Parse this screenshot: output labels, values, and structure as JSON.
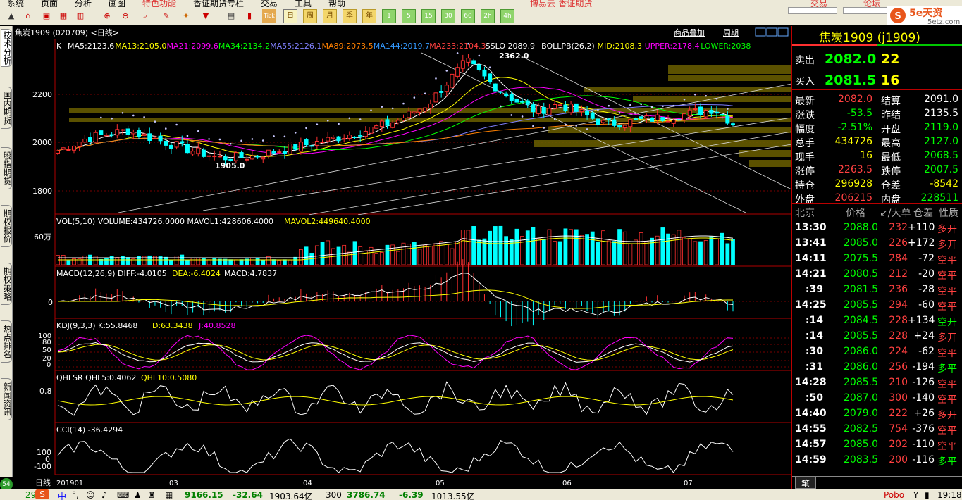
{
  "menubar": {
    "items": [
      "系统",
      "页面",
      "分析",
      "画图",
      "特色功能",
      "香证期货专栏",
      "交易",
      "工具",
      "帮助"
    ],
    "ad": "博易云-香证期货",
    "trade_btn": "交易",
    "forum_btn": "论坛"
  },
  "logo": {
    "main": "5e天资",
    "sub": "5etz.com"
  },
  "toolbar": {
    "day_btn": "日",
    "week_btn": "周",
    "month_btn": "月",
    "season_btn": "季",
    "year_btn": "年",
    "m1": "1",
    "m5": "5",
    "m15": "15",
    "m30": "30",
    "m60": "60",
    "h2": "2h",
    "h4": "4h"
  },
  "left_tabs": [
    "技术分析",
    "国内期货",
    "股指期货",
    "期权报价",
    "期权策略",
    "热点排名",
    "新闻资讯"
  ],
  "chart_header": {
    "symbol": "焦炭1909 (020709) <日线>",
    "link1": "商品叠加",
    "link2": "周期"
  },
  "price_pane": {
    "k_label": "K",
    "ma": [
      {
        "label": "MA5:2123.6",
        "color": "#ffffff"
      },
      {
        "label": "MA13:2105.0",
        "color": "#ffff00"
      },
      {
        "label": "MA21:2099.6",
        "color": "#ff00ff"
      },
      {
        "label": "MA34:2134.2",
        "color": "#00ff00"
      },
      {
        "label": "MA55:2126.1",
        "color": "#8080ff"
      },
      {
        "label": "MA89:2073.5",
        "color": "#ff8000"
      },
      {
        "label": "MA144:2019.7",
        "color": "#3399ff"
      },
      {
        "label": "MA233:2104.3",
        "color": "#ff4040"
      },
      {
        "label": "SSLO  2089.9",
        "color": "#ffffff"
      },
      {
        "label": "BOLLPB(26,2)",
        "color": "#ffffff"
      },
      {
        "label": "MID:2108.3",
        "color": "#ffff00"
      },
      {
        "label": "UPPER:2178.4",
        "color": "#ff00ff"
      },
      {
        "label": "LOWER:2038",
        "color": "#00ff00"
      }
    ],
    "y_ticks": [
      "2200",
      "2000",
      "1800"
    ],
    "high_label": "2362.0",
    "low_label": "1905.0"
  },
  "vol_pane": {
    "label": "VOL(5,10)  VOLUME:434726.0000  MAVOL1:428606.4000",
    "label2": "MAVOL2:449640.4000",
    "y_tick": "60万"
  },
  "macd_pane": {
    "label": "MACD(12,26,9)  DIFF:-4.0105",
    "dea": "DEA:-6.4024",
    "macd": "MACD:4.7837",
    "y_tick": "0"
  },
  "kdj_pane": {
    "label": "KDJ(9,3,3)  K:55.8468",
    "d": "D:63.3438",
    "j": "J:40.8528",
    "y_ticks": [
      "100",
      "80",
      "50",
      "20",
      "0"
    ]
  },
  "qhlsr_pane": {
    "label": "QHLSR  QHL5:0.4062",
    "l10": "QHL10:0.5080",
    "y_tick": "0.8"
  },
  "cci_pane": {
    "label": "CCI(14)  -36.4294",
    "y_ticks": [
      "100",
      "0",
      "-100"
    ]
  },
  "x_axis": {
    "period": "日线",
    "ticks": [
      "201901",
      "03",
      "04",
      "05",
      "06",
      "07"
    ]
  },
  "quote": {
    "title": "焦炭1909 (j1909)",
    "ask_label": "卖出",
    "ask_price": "2082.0",
    "ask_vol": "22",
    "bid_label": "买入",
    "bid_price": "2081.5",
    "bid_vol": "16",
    "rows": [
      {
        "l1": "最新",
        "v1": "2082.0",
        "c1": "#ff4040",
        "l2": "结算",
        "v2": "2091.0",
        "c2": "#ffffff"
      },
      {
        "l1": "涨跌",
        "v1": "-53.5",
        "c1": "#00ff00",
        "l2": "昨结",
        "v2": "2135.5",
        "c2": "#ffffff"
      },
      {
        "l1": "幅度",
        "v1": "-2.51%",
        "c1": "#00ff00",
        "l2": "开盘",
        "v2": "2119.0",
        "c2": "#00ff00"
      },
      {
        "l1": "总手",
        "v1": "434726",
        "c1": "#ffff00",
        "l2": "最高",
        "v2": "2127.0",
        "c2": "#00ff00"
      },
      {
        "l1": "现手",
        "v1": "16",
        "c1": "#ffff00",
        "l2": "最低",
        "v2": "2068.5",
        "c2": "#00ff00"
      },
      {
        "l1": "涨停",
        "v1": "2263.5",
        "c1": "#ff4040",
        "l2": "跌停",
        "v2": "2007.5",
        "c2": "#00ff00"
      },
      {
        "l1": "持仓",
        "v1": "296928",
        "c1": "#ffff00",
        "l2": "仓差",
        "v2": "-8542",
        "c2": "#ffff00"
      },
      {
        "l1": "外盘",
        "v1": "206215",
        "c1": "#ff4040",
        "l2": "内盘",
        "v2": "228511",
        "c2": "#00ff00"
      }
    ],
    "tick_header": {
      "c1": "北京",
      "c2": "价格",
      "c3": "↙/大单",
      "c4": "仓差",
      "c5": "性质"
    },
    "ticks": [
      {
        "t": "13:30",
        "p": "2088.0",
        "v": "232",
        "d": "+110",
        "n": "多开",
        "nc": "#ff4040"
      },
      {
        "t": "13:41",
        "p": "2085.0",
        "v": "226",
        "d": "+172",
        "n": "多开",
        "nc": "#ff4040"
      },
      {
        "t": "14:11",
        "p": "2075.5",
        "v": "284",
        "d": "-72",
        "n": "空平",
        "nc": "#ff4040"
      },
      {
        "t": "14:21",
        "p": "2080.5",
        "v": "212",
        "d": "-20",
        "n": "空平",
        "nc": "#ff4040"
      },
      {
        "t": ":39",
        "p": "2081.5",
        "v": "236",
        "d": "-28",
        "n": "空平",
        "nc": "#ff4040"
      },
      {
        "t": "14:25",
        "p": "2085.5",
        "v": "294",
        "d": "-60",
        "n": "空平",
        "nc": "#ff4040"
      },
      {
        "t": ":14",
        "p": "2084.5",
        "v": "228",
        "d": "+134",
        "n": "空开",
        "nc": "#00ff00"
      },
      {
        "t": ":14",
        "p": "2085.5",
        "v": "228",
        "d": "+24",
        "n": "多开",
        "nc": "#ff4040"
      },
      {
        "t": ":30",
        "p": "2086.0",
        "v": "224",
        "d": "-62",
        "n": "空平",
        "nc": "#ff4040"
      },
      {
        "t": ":31",
        "p": "2086.0",
        "v": "256",
        "d": "-194",
        "n": "多平",
        "nc": "#00ff00"
      },
      {
        "t": "14:28",
        "p": "2085.5",
        "v": "210",
        "d": "-126",
        "n": "空平",
        "nc": "#ff4040"
      },
      {
        "t": ":50",
        "p": "2087.0",
        "v": "300",
        "d": "-140",
        "n": "空平",
        "nc": "#ff4040"
      },
      {
        "t": "14:40",
        "p": "2079.0",
        "v": "222",
        "d": "+26",
        "n": "多开",
        "nc": "#ff4040"
      },
      {
        "t": "14:55",
        "p": "2082.5",
        "v": "754",
        "d": "-376",
        "n": "空平",
        "nc": "#ff4040"
      },
      {
        "t": "14:57",
        "p": "2085.0",
        "v": "202",
        "d": "-110",
        "n": "空平",
        "nc": "#ff4040"
      },
      {
        "t": "14:59",
        "p": "2083.5",
        "v": "200",
        "d": "-116",
        "n": "多平",
        "nc": "#00ff00"
      }
    ],
    "bottom_tab": "笔"
  },
  "status": {
    "badge": "54",
    "i1": "29",
    "idx1": "9166.15",
    "chg1": "-32.64",
    "amt1": "1903.64亿",
    "idx2_name": "300",
    "idx2": "3786.74",
    "chg2": "-6.39",
    "amt2": "1013.55亿",
    "right1": "Pobo",
    "time": "19:18"
  }
}
